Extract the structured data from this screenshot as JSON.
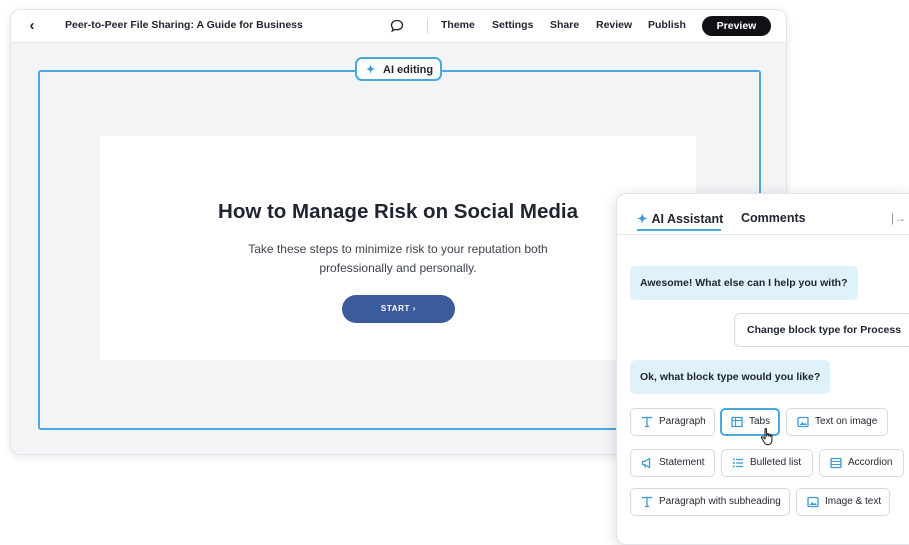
{
  "header": {
    "back_glyph": "‹",
    "document_title": "Peer-to-Peer File Sharing: A Guide for Business",
    "nav": [
      "Theme",
      "Settings",
      "Share",
      "Review",
      "Publish"
    ],
    "preview_label": "Preview"
  },
  "ai_editing": {
    "label": "AI editing",
    "icon": "sparkle-icon"
  },
  "content_card": {
    "title": "How to Manage Risk on Social Media",
    "subtitle": "Take these steps to minimize risk to your reputation both professionally and personally.",
    "start_label": "START ›"
  },
  "assistant_panel": {
    "tabs": [
      "AI Assistant",
      "Comments"
    ],
    "collapse_glyph": "|→",
    "messages": [
      {
        "role": "assistant",
        "text": "Awesome! What else can I help you with?"
      },
      {
        "role": "user",
        "text": "Change block type for ",
        "bold": "Process"
      },
      {
        "role": "assistant",
        "text": "Ok, what block type would you like?"
      }
    ],
    "block_types": [
      {
        "label": "Paragraph",
        "icon": "text-t-icon",
        "active": false
      },
      {
        "label": "Tabs",
        "icon": "tabs-icon",
        "active": true
      },
      {
        "label": "Text on image",
        "icon": "image-icon",
        "active": false
      },
      {
        "label": "Statement",
        "icon": "megaphone-icon",
        "active": false
      },
      {
        "label": "Bulleted list",
        "icon": "list-icon",
        "active": false
      },
      {
        "label": "Accordion",
        "icon": "accordion-icon",
        "active": false
      },
      {
        "label": "Paragraph with subheading",
        "icon": "text-t-icon",
        "active": false
      },
      {
        "label": "Image & text",
        "icon": "image-icon",
        "active": false
      }
    ]
  },
  "colors": {
    "accent": "#4aa8de",
    "button": "#3a5c9a",
    "bubble": "#dff1fb"
  }
}
